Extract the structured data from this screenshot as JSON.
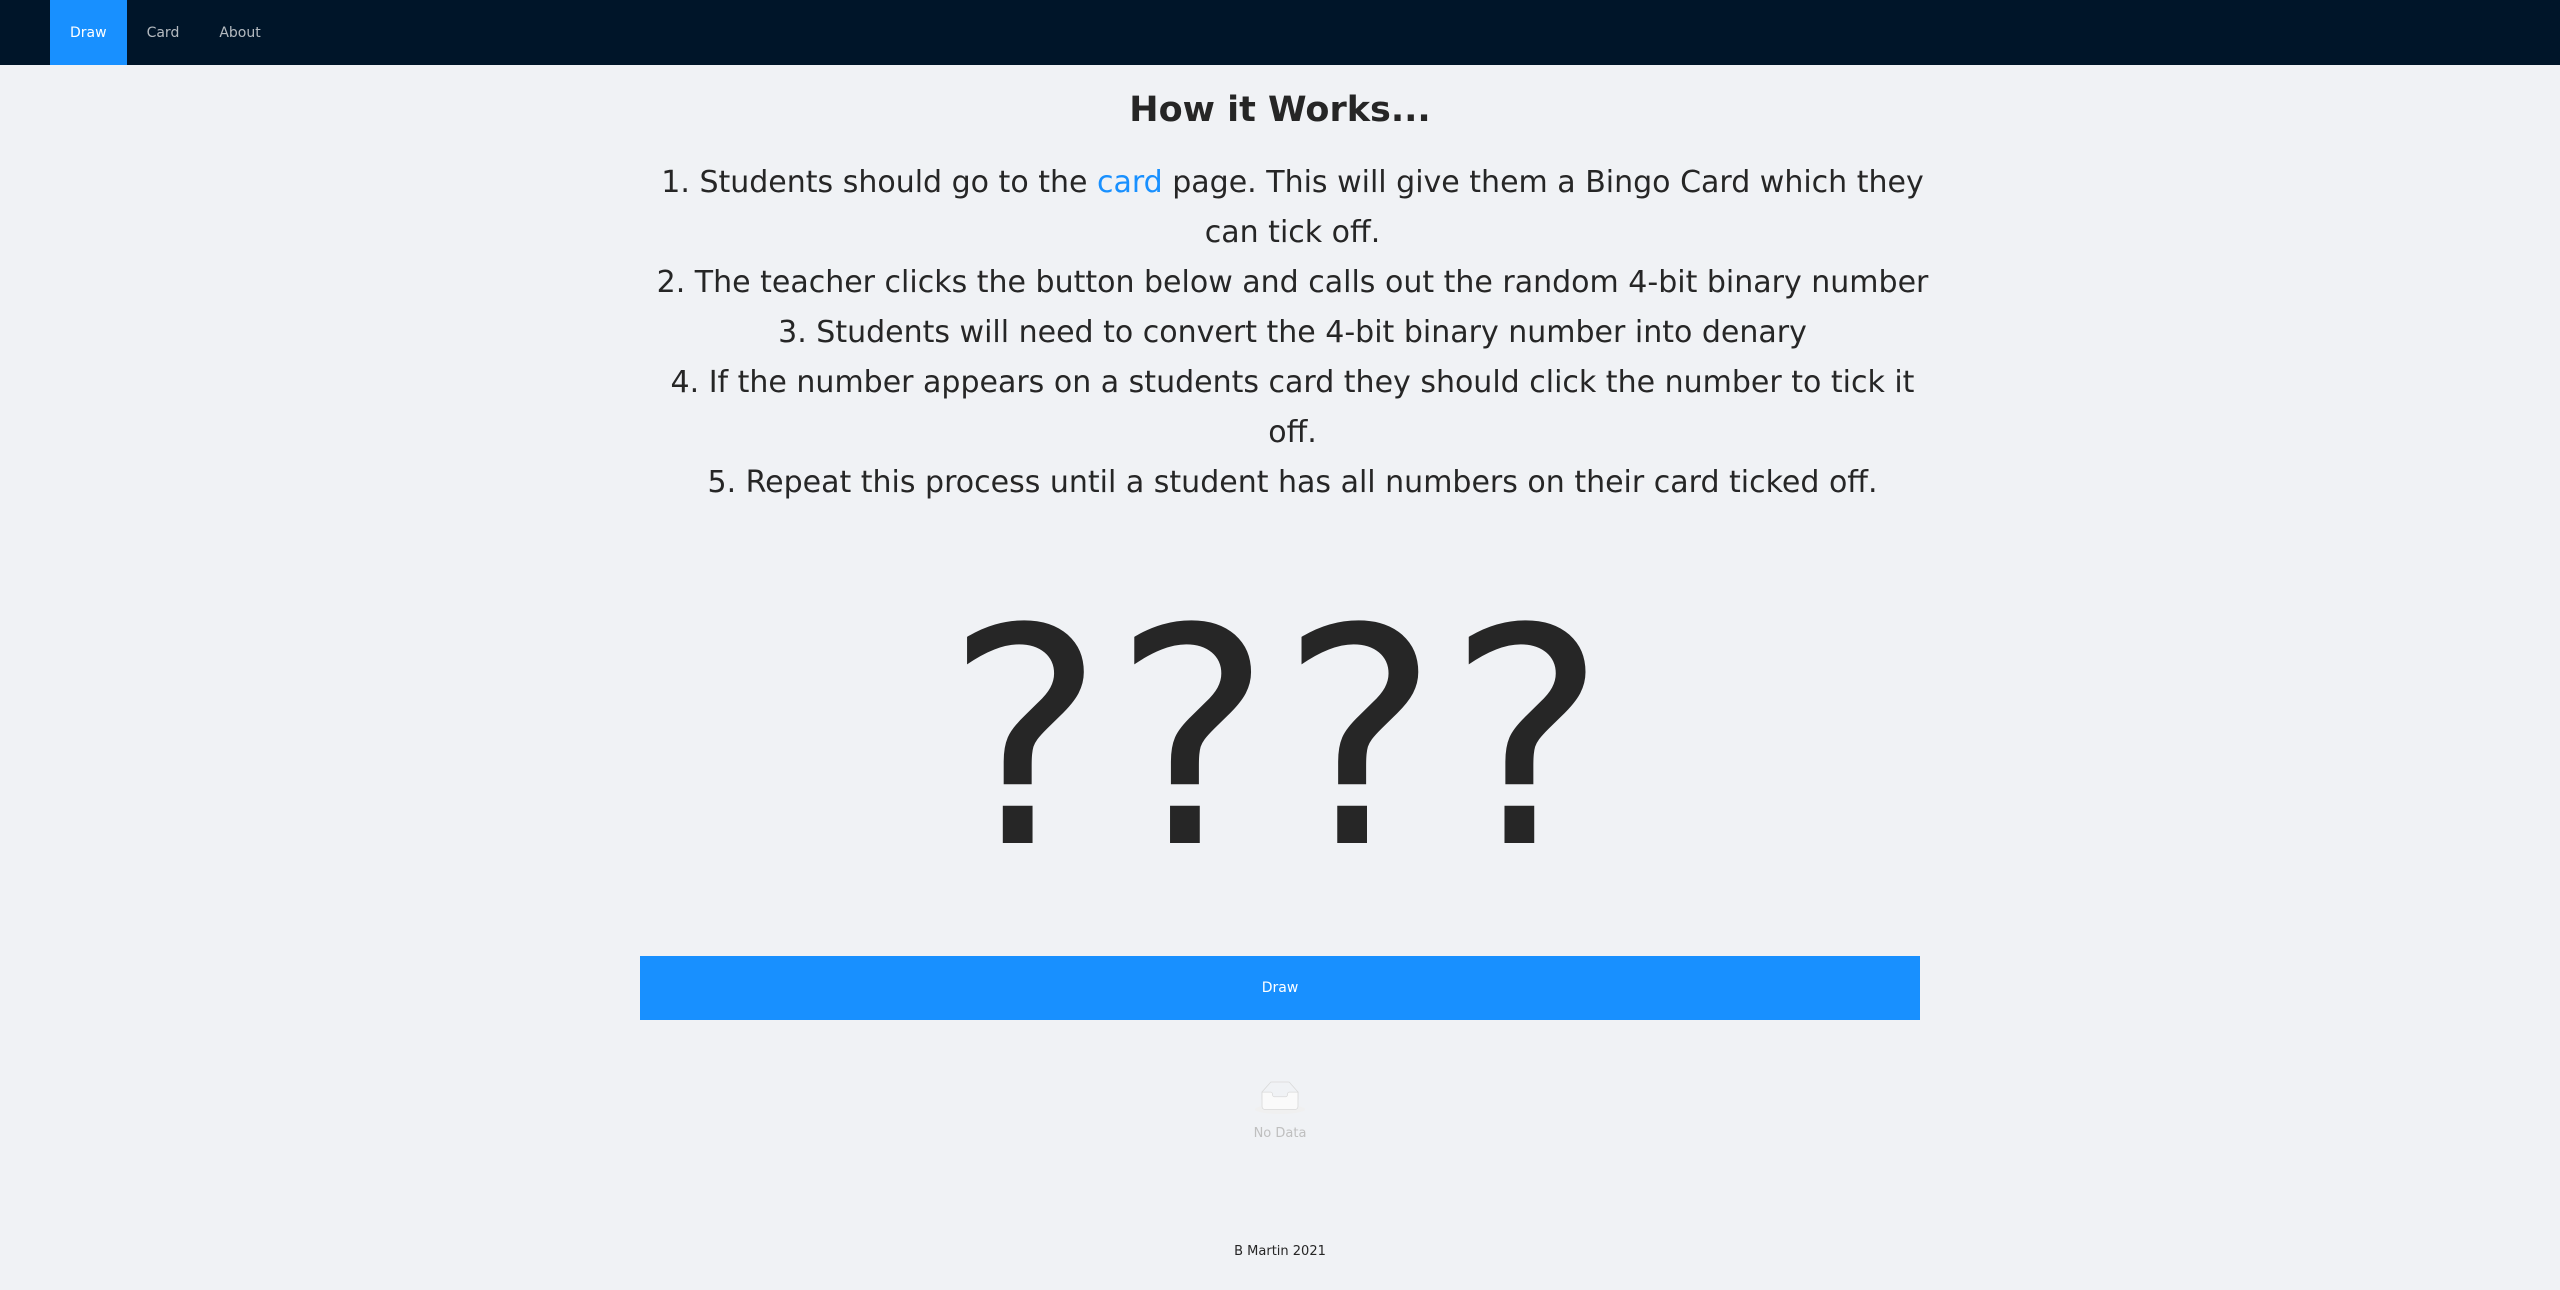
{
  "nav": {
    "items": [
      {
        "label": "Draw",
        "active": true
      },
      {
        "label": "Card",
        "active": false
      },
      {
        "label": "About",
        "active": false
      }
    ]
  },
  "main": {
    "title": "How it Works...",
    "steps": {
      "s1_prefix": "1. Students should go to the ",
      "s1_link": "card",
      "s1_suffix": " page. This will give them a Bingo Card which they can tick off.",
      "s2": "2. The teacher clicks the button below and calls out the random 4-bit binary number",
      "s3": "3. Students will need to convert the 4-bit binary number into denary",
      "s4": "4. If the number appears on a students card they should click the number to tick it off.",
      "s5": "5. Repeat this process until a student has all numbers on their card ticked off."
    },
    "number_display": "????",
    "draw_button": "Draw",
    "empty_state": {
      "icon": "inbox-icon",
      "text": "No Data"
    }
  },
  "footer": {
    "text": "B Martin 2021"
  },
  "colors": {
    "nav_bg": "#001529",
    "accent": "#1890ff",
    "page_bg": "#f0f2f5"
  }
}
